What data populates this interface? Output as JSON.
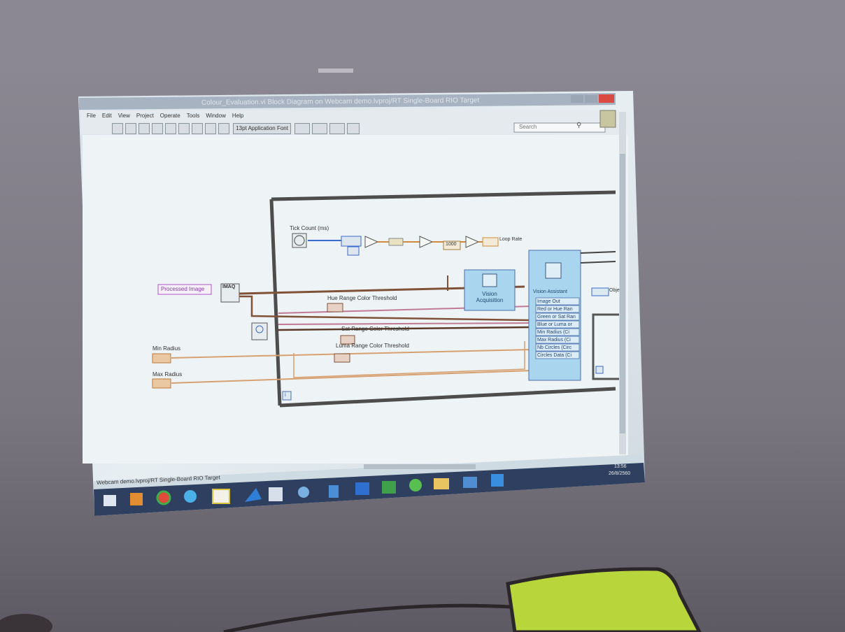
{
  "window": {
    "title": "Colour_Evaluation.vi Block Diagram on Webcam demo.lvproj/RT Single-Board RIO Target",
    "menu": [
      "File",
      "Edit",
      "View",
      "Project",
      "Operate",
      "Tools",
      "Window",
      "Help"
    ],
    "font_selector": "13pt Application Font",
    "search_placeholder": "Search",
    "status_path": "Webcam demo.lvproj/RT Single-Board RIO Target"
  },
  "diagram": {
    "tick_count_label": "Tick Count (ms)",
    "const_1000": "1000",
    "loop_rate_label": "Loop Rate",
    "processed_image_label": "Processed Image",
    "imaq_label": "IMAQ",
    "vision_acquisition_label": "Vision Acquisition",
    "vision_assistant_label": "Vision Assistant",
    "vision_assistant_ports": [
      "Image Out",
      "Red or Hue Ran",
      "Green or Sat Ran",
      "Blue or Luma or",
      "Min Radius (Ci",
      "Max Radius (Ci",
      "Nb Circles (Circ",
      "Circles Data (Ci"
    ],
    "hue_label": "Hue Range Color Threshold",
    "sat_label": "Sat Range Color Threshold",
    "luma_label": "Luma Range Color Threshold",
    "min_radius_label": "Min Radius",
    "max_radius_label": "Max Radius",
    "objects_label": "Obje",
    "loop_iteration": "i"
  },
  "taskbar": {
    "apps": [
      "start",
      "office",
      "chrome",
      "ie",
      "labview",
      "matlab",
      "vi",
      "settings",
      "notes",
      "word",
      "excel",
      "line",
      "folder",
      "remote",
      "skype"
    ],
    "clock_time": "13:56",
    "clock_date": "26/8/2560"
  },
  "colors": {
    "wall": "#7b7782",
    "projection": "#dfe8ee",
    "title_bar": "#9eaab8",
    "taskbar": "#2e3f5e",
    "chair": "#b5d43a",
    "loop_border": "#4a4a4a",
    "vi_blue": "#a8d4ec",
    "wire_brown": "#8b5a3c",
    "wire_blue": "#3a6ad0"
  }
}
